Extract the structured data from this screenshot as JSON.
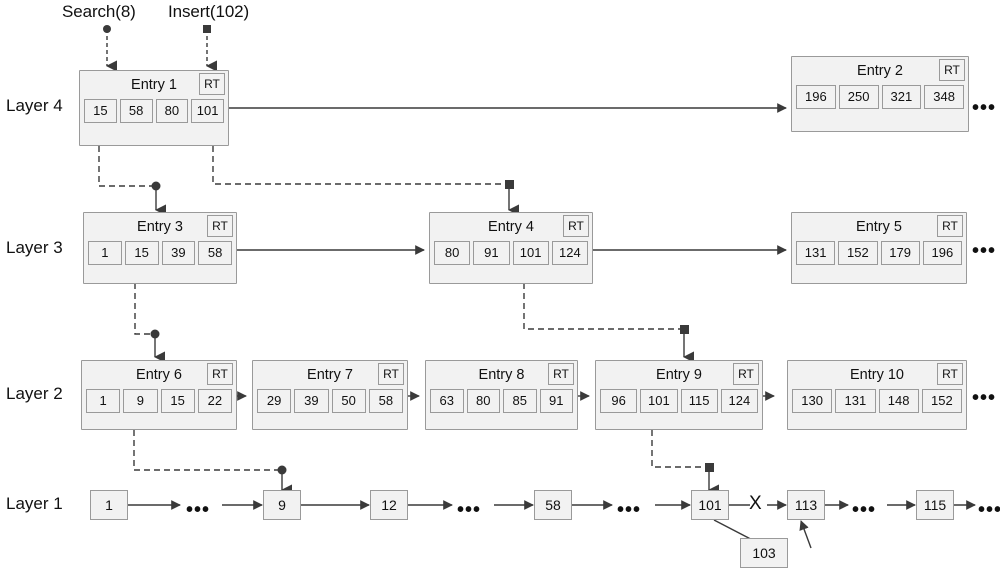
{
  "figure": {
    "title": "Multi-layer index structure with search and insert paths",
    "background_color": "#ffffff",
    "node_fill": "#f2f2f2",
    "node_border": "#9a9a9a",
    "line_color": "#3a3a3a"
  },
  "operations": [
    {
      "id": "search",
      "label": "Search(8)",
      "endpoint": "circle"
    },
    {
      "id": "insert",
      "label": "Insert(102)",
      "endpoint": "square"
    }
  ],
  "layers": [
    {
      "id": "layer4",
      "label": "Layer 4"
    },
    {
      "id": "layer3",
      "label": "Layer 3"
    },
    {
      "id": "layer2",
      "label": "Layer 2"
    },
    {
      "id": "layer1",
      "label": "Layer 1"
    }
  ],
  "rt_badge": "RT",
  "ellipsis": "•••",
  "x_mark": "X",
  "entries": {
    "entry1": {
      "title": "Entry 1",
      "rt": "RT",
      "cells": [
        "15",
        "58",
        "80",
        "101"
      ]
    },
    "entry2": {
      "title": "Entry 2",
      "rt": "RT",
      "cells": [
        "196",
        "250",
        "321",
        "348"
      ]
    },
    "entry3": {
      "title": "Entry 3",
      "rt": "RT",
      "cells": [
        "1",
        "15",
        "39",
        "58"
      ]
    },
    "entry4": {
      "title": "Entry 4",
      "rt": "RT",
      "cells": [
        "80",
        "91",
        "101",
        "124"
      ]
    },
    "entry5": {
      "title": "Entry 5",
      "rt": "RT",
      "cells": [
        "131",
        "152",
        "179",
        "196"
      ]
    },
    "entry6": {
      "title": "Entry 6",
      "rt": "RT",
      "cells": [
        "1",
        "9",
        "15",
        "22"
      ]
    },
    "entry7": {
      "title": "Entry 7",
      "rt": "RT",
      "cells": [
        "29",
        "39",
        "50",
        "58"
      ]
    },
    "entry8": {
      "title": "Entry 8",
      "rt": "RT",
      "cells": [
        "63",
        "80",
        "85",
        "91"
      ]
    },
    "entry9": {
      "title": "Entry 9",
      "rt": "RT",
      "cells": [
        "96",
        "101",
        "115",
        "124"
      ]
    },
    "entry10": {
      "title": "Entry 10",
      "rt": "RT",
      "cells": [
        "130",
        "131",
        "148",
        "152"
      ]
    }
  },
  "layer1_nodes": [
    {
      "id": "n1",
      "label": "1"
    },
    {
      "id": "n9",
      "label": "9"
    },
    {
      "id": "n12",
      "label": "12"
    },
    {
      "id": "n58",
      "label": "58"
    },
    {
      "id": "n101",
      "label": "101"
    },
    {
      "id": "n113",
      "label": "113"
    },
    {
      "id": "n115",
      "label": "115"
    },
    {
      "id": "n103",
      "label": "103"
    }
  ],
  "layer1_ellipses": [
    "•••",
    "•••",
    "•••",
    "•••",
    "•••"
  ],
  "layer_tail_ellipses": {
    "layer4": "•••",
    "layer3": "•••",
    "layer2": "•••"
  }
}
